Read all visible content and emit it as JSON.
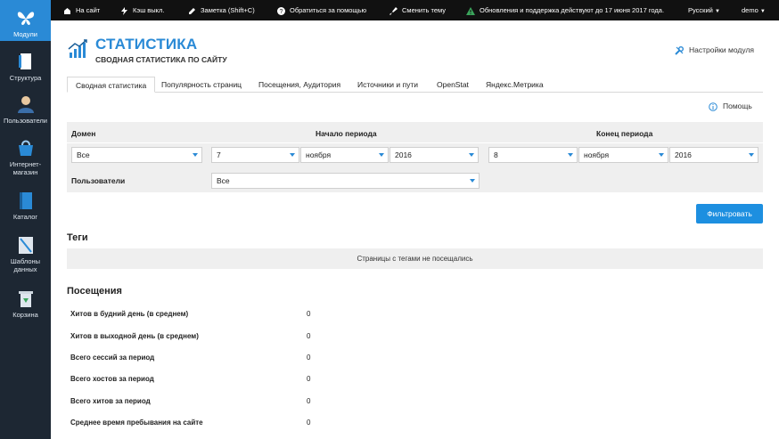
{
  "sidebar": {
    "items": [
      {
        "label": "Модули",
        "icon": "butterfly-icon"
      },
      {
        "label": "Структура",
        "icon": "structure-icon"
      },
      {
        "label": "Пользователи",
        "icon": "users-icon"
      },
      {
        "label": "Интернет-магазин",
        "icon": "shop-icon"
      },
      {
        "label": "Каталог",
        "icon": "catalog-icon"
      },
      {
        "label": "Шаблоны данных",
        "icon": "templates-icon"
      },
      {
        "label": "Корзина",
        "icon": "trash-icon"
      }
    ]
  },
  "topbar": {
    "site": "На сайт",
    "cache": "Кэш выкл.",
    "note": "Заметка (Shift+C)",
    "support": "Обратиться за помощью",
    "theme": "Сменить тему",
    "updates": "Обновления и поддержка действуют до 17 июня 2017 года.",
    "language": "Русский",
    "user": "demo"
  },
  "header": {
    "title": "СТАТИСТИКА",
    "subtitle": "СВОДНАЯ СТАТИСТИКА ПО САЙТУ",
    "settings": "Настройки модуля"
  },
  "tabs": [
    "Сводная статистика",
    "Популярность страниц",
    "Посещения, Аудитория",
    "Источники и пути",
    "OpenStat",
    "Яндекс.Метрика"
  ],
  "help": "Помощь",
  "filter": {
    "domain_label": "Домен",
    "start_label": "Начало периода",
    "end_label": "Конец периода",
    "users_label": "Пользователи",
    "domain_value": "Все",
    "start_day": "7",
    "start_month": "ноября",
    "start_year": "2016",
    "end_day": "8",
    "end_month": "ноября",
    "end_year": "2016",
    "users_value": "Все",
    "button": "Фильтровать"
  },
  "tags": {
    "title": "Теги",
    "empty": "Страницы с тегами не посещались"
  },
  "visits": {
    "title": "Посещения",
    "rows": [
      {
        "label": "Хитов в будний день (в среднем)",
        "value": "0"
      },
      {
        "label": "Хитов в выходной день (в среднем)",
        "value": "0"
      },
      {
        "label": "Всего сессий за период",
        "value": "0"
      },
      {
        "label": "Всего хостов за период",
        "value": "0"
      },
      {
        "label": "Всего хитов за период",
        "value": "0"
      },
      {
        "label": "Среднее время пребывания на сайте",
        "value": "0"
      }
    ]
  },
  "colors": {
    "accent": "#2a8ad6",
    "sidebar": "#1d2733",
    "topbar": "#111111"
  }
}
